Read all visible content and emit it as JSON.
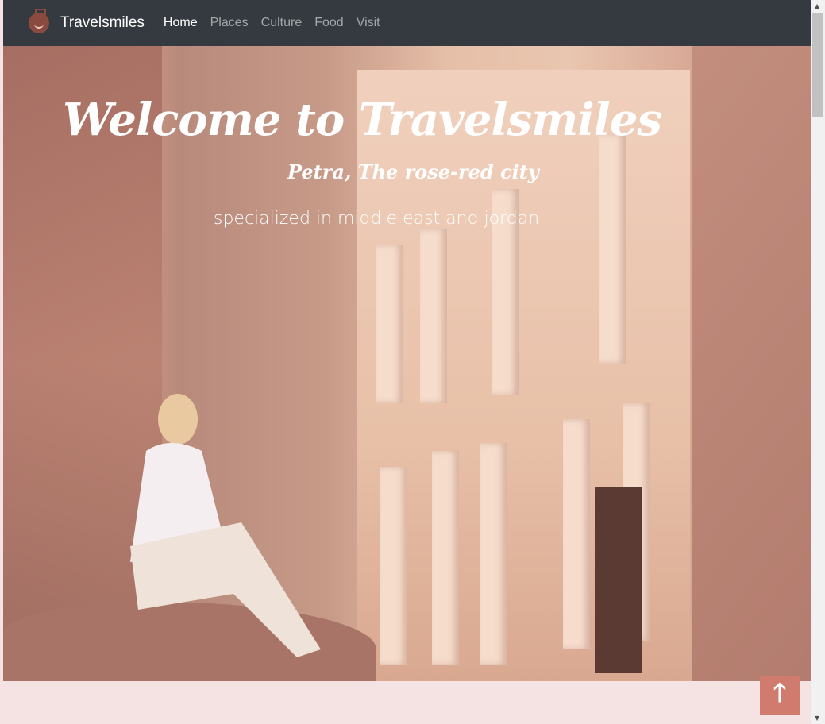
{
  "nav": {
    "brand": "Travelsmiles",
    "items": [
      {
        "label": "Home",
        "active": true
      },
      {
        "label": "Places"
      },
      {
        "label": "Culture"
      },
      {
        "label": "Food"
      },
      {
        "label": "Visit"
      }
    ]
  },
  "hero": {
    "title": "Welcome to Travelsmiles",
    "subtitle": "Petra, The rose-red city",
    "tagline": "specialized in middle east and jordan"
  },
  "back_to_top": {
    "icon": "arrow-up-icon",
    "glyph": "🡑"
  },
  "colors": {
    "nav_bg": "#343a40",
    "button": "#d17a6e",
    "footer_bg": "#f5e3e3"
  }
}
